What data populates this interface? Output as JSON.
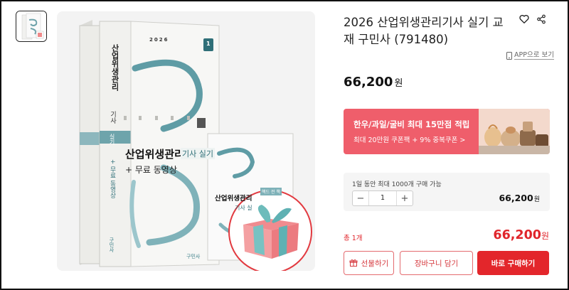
{
  "product": {
    "title": "2026 산업위생관리기사 실기 교재 구민사 (791480)",
    "price_value": "66,200",
    "price_unit": "원"
  },
  "header_actions": {
    "wishlist_icon": "heart-icon",
    "share_icon": "share-icon",
    "app_link_label": "APP으로 보기"
  },
  "book_cover": {
    "year": "2026",
    "main_title": "산업위생관리",
    "type_label": "기사 실기",
    "subtitle": "+ 무료 동영상",
    "spine_title": "산업위생관리",
    "spine_type": "기사",
    "spine_level": "실기",
    "spine_sub": "+ 무료 동영상",
    "volume": "1",
    "publisher_logo": "구민사",
    "second_title": "산업위생관리",
    "second_type": "기사 실",
    "bonus_tag": "핵드 전 책"
  },
  "banner": {
    "headline": "한우/과일/굴비 최대 15만점 적립",
    "subline": "최대 20만원 쿠폰팩 + 9% 중복쿠폰 >",
    "bg_color": "#ef5e6b"
  },
  "option": {
    "limit_text": "1일 동안 최대 1000개 구매 가능",
    "quantity": "1",
    "minus_label": "−",
    "plus_label": "+",
    "price_value": "66,200",
    "price_unit": "원"
  },
  "total": {
    "label": "총 1개",
    "value": "66,200",
    "unit": "원"
  },
  "buttons": {
    "gift_label": "선물하기",
    "cart_label": "장바구니 담기",
    "buy_label": "바로 구매하기",
    "accent_color": "#e3262b"
  }
}
